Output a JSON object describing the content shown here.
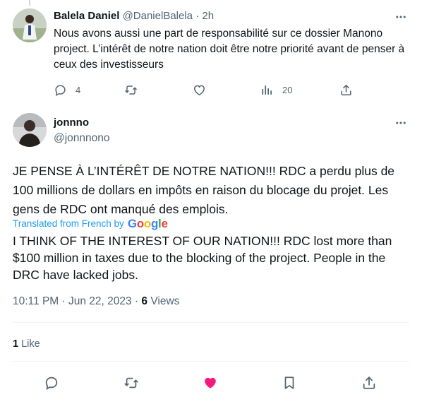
{
  "reply": {
    "name": "Balela Daniel",
    "handle": "@DanielBalela",
    "separator": "·",
    "time": "2h",
    "text": "Nous avons aussi une part de responsabilité sur ce dossier Manono project. L’intérêt de notre nation doit être notre priorité avant de penser à ceux des investisseurs",
    "actions": {
      "reply_count": "4",
      "retweet_count": "",
      "like_count": "",
      "views_count": "20"
    }
  },
  "tweet": {
    "name": "jonnno",
    "handle": "@jonnnono",
    "text": "JE PENSE À L’INTÉRÊT DE NOTRE NATION!!! RDC a perdu plus de 100 millions de dollars en impôts en raison du blocage du projet. Les gens de RDC ont manqué des emplois.",
    "translated_label": "Translated from French by",
    "translator_brand": "Google",
    "translation": "I THINK OF THE INTEREST OF OUR NATION!!! RDC lost more than $100 million in taxes due to the blocking of the project. People in the DRC have lacked jobs.",
    "timestamp": "10:11 PM · Jun 22, 2023",
    "meta_separator": "·",
    "views_count": "6",
    "views_label": "Views",
    "likes_count": "1",
    "likes_label": "Like"
  },
  "icons": [
    "more-icon",
    "reply-icon",
    "retweet-icon",
    "like-icon",
    "views-icon",
    "share-icon",
    "bookmark-icon"
  ],
  "colors": {
    "text": "#0f1419",
    "secondary": "#536471",
    "link": "#1d9bf0",
    "liked": "#f91880",
    "divider": "#eff3f4"
  }
}
